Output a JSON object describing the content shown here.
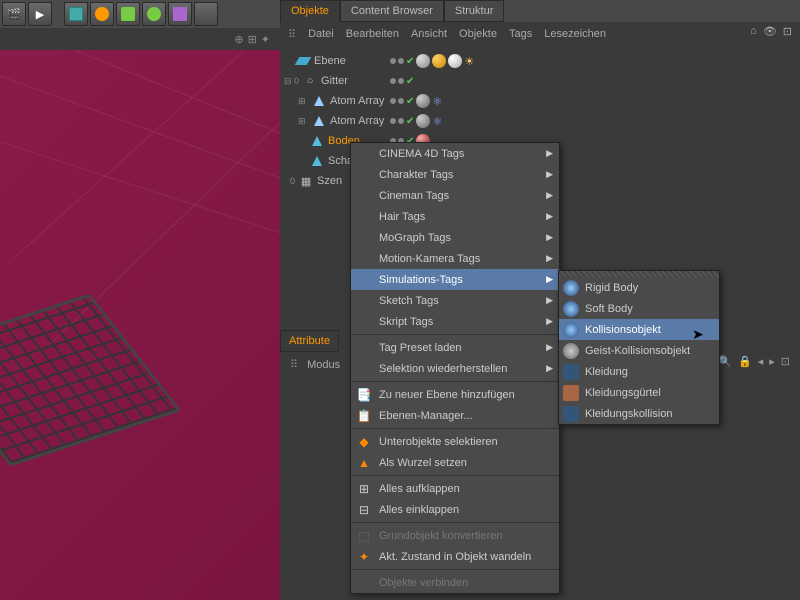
{
  "toolbar": {
    "icons": [
      "director",
      "clip",
      "cube",
      "spiral",
      "cube2",
      "gear",
      "cube3",
      "blank"
    ]
  },
  "tabs": {
    "objects": "Objekte",
    "content_browser": "Content Browser",
    "structure": "Struktur"
  },
  "menubar": {
    "file": "Datei",
    "edit": "Bearbeiten",
    "view": "Ansicht",
    "objects": "Objekte",
    "tags": "Tags",
    "bookmarks": "Lesezeichen"
  },
  "tree": {
    "items": [
      {
        "name": "Ebene",
        "indent": 0
      },
      {
        "name": "Gitter",
        "indent": 0
      },
      {
        "name": "Atom Array",
        "indent": 1
      },
      {
        "name": "Atom Array",
        "indent": 1
      },
      {
        "name": "Boden",
        "indent": 1,
        "selected": true
      },
      {
        "name": "Scha",
        "indent": 1
      },
      {
        "name": "Szen",
        "indent": 0
      }
    ]
  },
  "context_menu": {
    "groups": [
      [
        "CINEMA 4D Tags",
        "Charakter Tags",
        "Cineman Tags",
        "Hair Tags",
        "MoGraph Tags",
        "Motion-Kamera Tags",
        "Simulations-Tags",
        "Sketch Tags",
        "Skript Tags"
      ],
      [
        "Tag Preset laden",
        "Selektion wiederherstellen"
      ],
      [
        "Zu neuer Ebene hinzufügen",
        "Ebenen-Manager..."
      ],
      [
        "Unterobjekte selektieren",
        "Als Wurzel setzen"
      ],
      [
        "Alles aufklappen",
        "Alles einklappen"
      ],
      [
        "Grundobjekt konvertieren",
        "Akt. Zustand in Objekt wandeln"
      ],
      [
        "Objekte verbinden"
      ]
    ],
    "highlighted": "Simulations-Tags"
  },
  "submenu": {
    "items": [
      "Rigid Body",
      "Soft Body",
      "Kollisionsobjekt",
      "Geist-Kollisionsobjekt",
      "Kleidung",
      "Kleidungsgürtel",
      "Kleidungskollision"
    ],
    "highlighted": "Kollisionsobjekt"
  },
  "attribute": {
    "title": "Attribute",
    "mode": "Modus"
  }
}
